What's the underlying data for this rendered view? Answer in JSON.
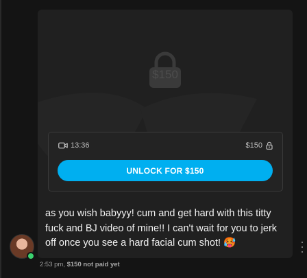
{
  "post": {
    "locked_price": "$150",
    "duration": "13:36",
    "price": "$150",
    "unlock_label": "UNLOCK FOR $150"
  },
  "message": {
    "text": "as you wish babyyy! cum and get hard with this titty fuck and BJ video of mine!! I can't wait for you to jerk off once you see a hard facial cum shot! 🥵"
  },
  "meta": {
    "time": "2:53 pm,",
    "status": "$150 not paid yet"
  },
  "colors": {
    "accent": "#00aff0",
    "online": "#3bd16f"
  }
}
